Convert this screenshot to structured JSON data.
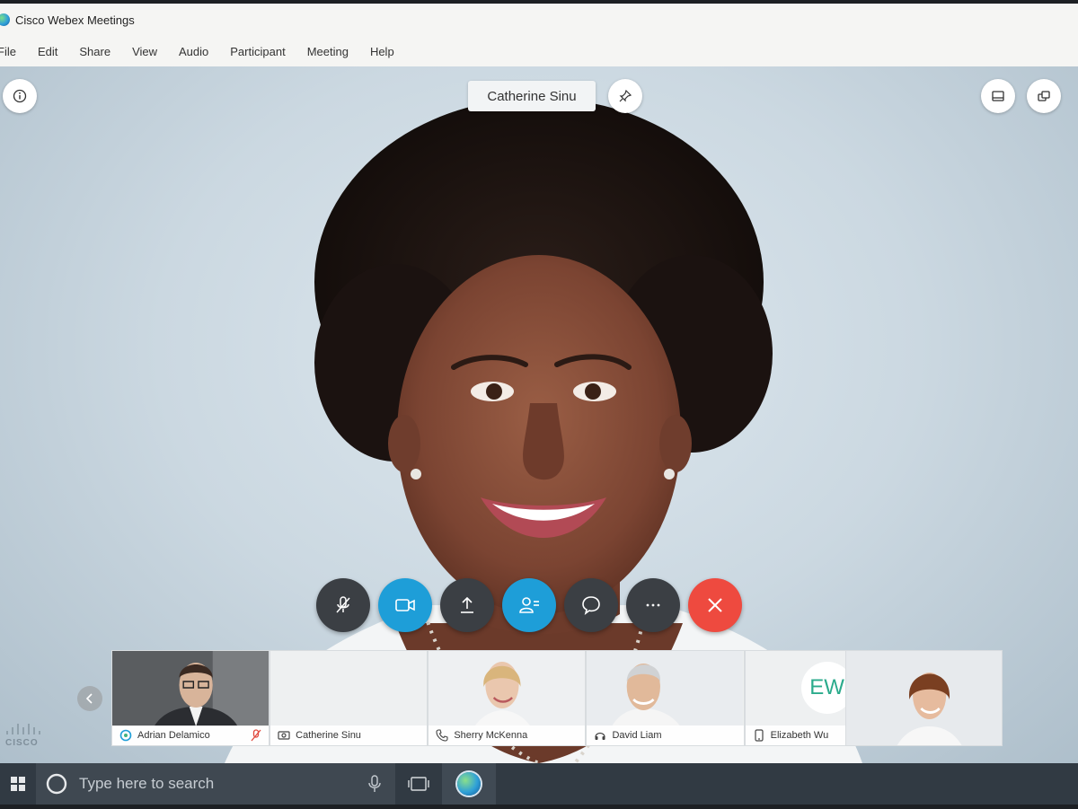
{
  "window": {
    "title": "Cisco Webex Meetings",
    "logo_icon": "webex-logo-icon"
  },
  "menu": {
    "items": [
      {
        "label": "File"
      },
      {
        "label": "Edit"
      },
      {
        "label": "Share"
      },
      {
        "label": "View"
      },
      {
        "label": "Audio"
      },
      {
        "label": "Participant"
      },
      {
        "label": "Meeting"
      },
      {
        "label": "Help"
      }
    ]
  },
  "stage": {
    "active_speaker": "Catherine Sinu",
    "info_icon": "info-icon",
    "pin_icon": "pin-icon",
    "layout_icon": "layout-icon",
    "popout_icon": "popout-icon"
  },
  "controls": [
    {
      "name": "mute-button",
      "icon": "mic-muted-icon",
      "style": "dark"
    },
    {
      "name": "video-button",
      "icon": "video-camera-icon",
      "style": "blue"
    },
    {
      "name": "share-button",
      "icon": "upload-share-icon",
      "style": "dark"
    },
    {
      "name": "participants-button",
      "icon": "participants-icon",
      "style": "blue"
    },
    {
      "name": "chat-button",
      "icon": "chat-bubble-icon",
      "style": "dark"
    },
    {
      "name": "more-button",
      "icon": "ellipsis-icon",
      "style": "dark"
    },
    {
      "name": "leave-button",
      "icon": "close-x-icon",
      "style": "red"
    }
  ],
  "participants": [
    {
      "name": "Adrian Delamico",
      "icon": "webex-app-icon",
      "muted": true
    },
    {
      "name": "Catherine Sinu",
      "icon": "video-device-icon",
      "muted": false
    },
    {
      "name": "Sherry McKenna",
      "icon": "phone-icon",
      "muted": false
    },
    {
      "name": "David Liam",
      "icon": "headset-icon",
      "muted": false
    },
    {
      "name": "Elizabeth Wu",
      "icon": "mobile-icon",
      "muted": false,
      "initials": "EW"
    }
  ],
  "branding": {
    "text": "CISCO"
  },
  "taskbar": {
    "search_placeholder": "Type here to search"
  },
  "colors": {
    "accent_blue": "#1e9ed8",
    "control_dark": "#3b3f44",
    "leave_red": "#ee4a3f",
    "initials_green": "#2bab8c",
    "taskbar": "#313a43"
  }
}
